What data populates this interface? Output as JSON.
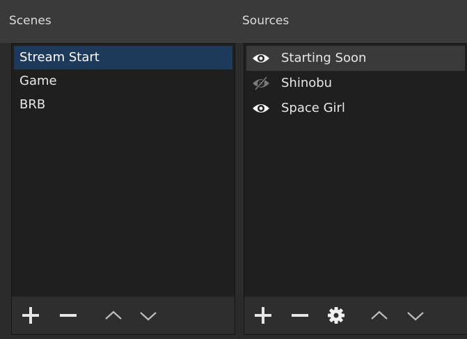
{
  "scenes": {
    "title": "Scenes",
    "items": [
      {
        "label": "Stream Start",
        "selected": true
      },
      {
        "label": "Game",
        "selected": false
      },
      {
        "label": "BRB",
        "selected": false
      }
    ],
    "toolbar": {
      "buttons": [
        "add-icon",
        "remove-icon",
        "move-up-icon",
        "move-down-icon"
      ]
    }
  },
  "sources": {
    "title": "Sources",
    "items": [
      {
        "label": "Starting Soon",
        "visible": true,
        "selected": true
      },
      {
        "label": "Shinobu",
        "visible": false,
        "selected": false
      },
      {
        "label": "Space Girl",
        "visible": true,
        "selected": false
      }
    ],
    "toolbar": {
      "buttons": [
        "add-icon",
        "remove-icon",
        "gear-icon",
        "move-up-icon",
        "move-down-icon"
      ]
    }
  },
  "colors": {
    "selected_scene": "#1e3a5b",
    "selected_source": "#3a3a3a",
    "panel_bg": "#1f1f1f",
    "header_bg": "#3a3a3a"
  }
}
